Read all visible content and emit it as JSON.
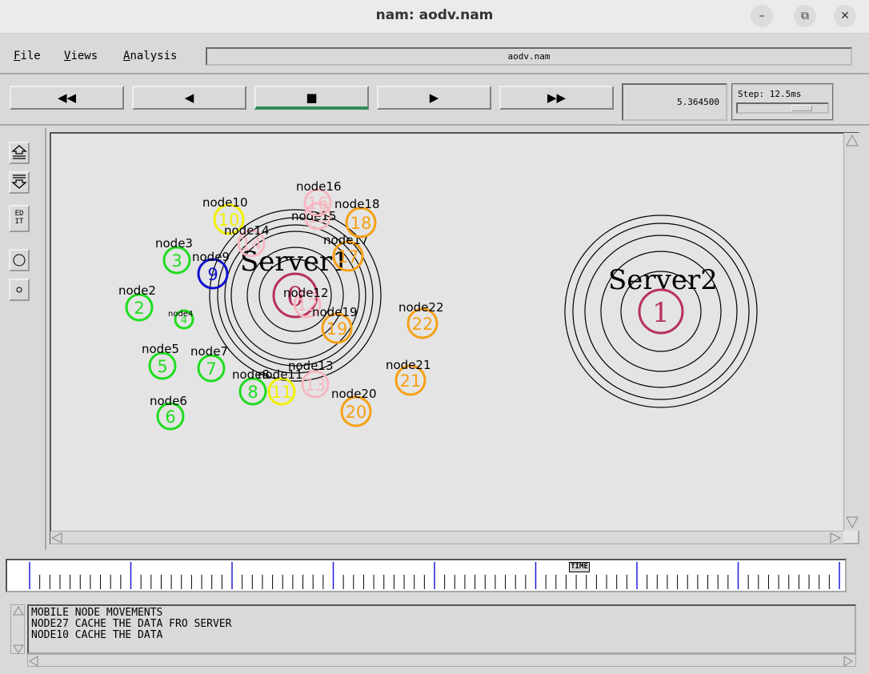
{
  "window": {
    "title": "nam: aodv.nam",
    "minimize": "–",
    "restore": "⧉",
    "close": "✕"
  },
  "menu": {
    "file": "File",
    "views": "Views",
    "analysis": "Analysis",
    "filename": "aodv.nam"
  },
  "controls": {
    "rewind": "◀◀",
    "back": "◀",
    "stop": "■",
    "play": "▶",
    "fast_forward": "▶▶",
    "time": "5.364500",
    "step_label": "Step: 12.5ms",
    "step_level": 0.78
  },
  "sidebar": {
    "zoom_in": "zoom-in-icon",
    "zoom_out": "zoom-out-icon",
    "edit": "ED IT"
  },
  "timeline": {
    "label": "TIME",
    "position_fraction": 0.685
  },
  "messages": [
    "MOBILE NODE MOVEMENTS",
    "NODE27 CACHE THE DATA FRO SERVER",
    "NODE10 CACHE THE DATA"
  ],
  "colors": {
    "green": "#1fdc1f",
    "blue": "#1010d0",
    "yellow": "#f0f000",
    "pink": "#f6b7c1",
    "orange": "#f5a014",
    "server": "#b8305f"
  },
  "topology": {
    "servers": [
      {
        "id": "0",
        "label": "Server1"
      },
      {
        "id": "1",
        "label": "Server2"
      }
    ],
    "nodes": [
      {
        "id": "2",
        "label": "node2",
        "color": "green"
      },
      {
        "id": "3",
        "label": "node3",
        "color": "green"
      },
      {
        "id": "4",
        "label": "node4",
        "color": "green"
      },
      {
        "id": "5",
        "label": "node5",
        "color": "green"
      },
      {
        "id": "6",
        "label": "node6",
        "color": "green"
      },
      {
        "id": "7",
        "label": "node7",
        "color": "green"
      },
      {
        "id": "8",
        "label": "node8",
        "color": "green"
      },
      {
        "id": "9",
        "label": "node9",
        "color": "blue"
      },
      {
        "id": "10",
        "label": "node10",
        "color": "yellow"
      },
      {
        "id": "11",
        "label": "node11",
        "color": "yellow"
      },
      {
        "id": "12",
        "label": "node12",
        "color": "pink"
      },
      {
        "id": "13",
        "label": "node13",
        "color": "pink"
      },
      {
        "id": "14",
        "label": "node14",
        "color": "pink"
      },
      {
        "id": "15",
        "label": "node15",
        "color": "pink"
      },
      {
        "id": "16",
        "label": "node16",
        "color": "pink"
      },
      {
        "id": "17",
        "label": "node17",
        "color": "orange"
      },
      {
        "id": "18",
        "label": "node18",
        "color": "orange"
      },
      {
        "id": "19",
        "label": "node19",
        "color": "orange"
      },
      {
        "id": "20",
        "label": "node20",
        "color": "orange"
      },
      {
        "id": "21",
        "label": "node21",
        "color": "orange"
      },
      {
        "id": "22",
        "label": "node22",
        "color": "orange"
      }
    ]
  }
}
